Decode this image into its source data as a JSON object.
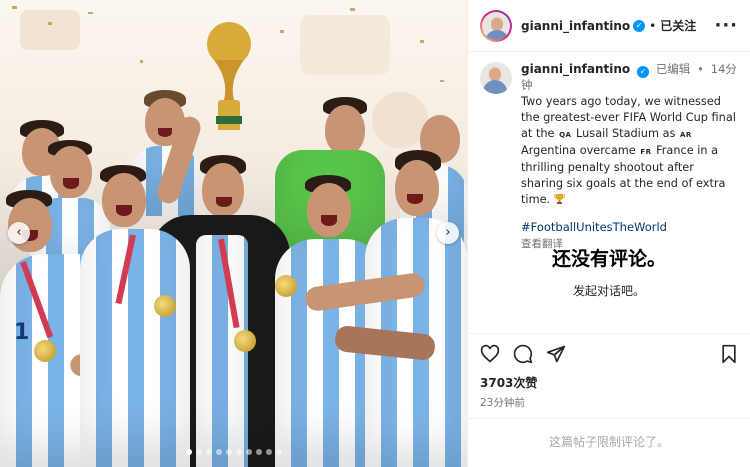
{
  "post": {
    "media": {
      "alt_description_hidden": "",
      "carousel_dots": 10,
      "active_dot": 0
    },
    "header": {
      "username": "gianni_infantino",
      "separator": "•",
      "follow_status": "已关注",
      "more_icon": "more-horizontal-icon"
    },
    "caption": {
      "username": "gianni_infantino",
      "edited": "已编辑",
      "separator": "•",
      "age": "14分钟",
      "text_1": "Two years ago today, we witnessed the greatest-ever FIFA World Cup final at the",
      "flag_qa": "QA",
      "text_2": "Lusail Stadium as",
      "flag_ar": "AR",
      "text_3": "Argentina overcame",
      "flag_fr": "FR",
      "text_4": "France in a thrilling penalty shootout after sharing six goals at the end of extra time.",
      "hashtag": "#FootballUnitesTheWorld",
      "translate": "查看翻译"
    },
    "comments": {
      "empty_title": "还没有评论。",
      "empty_subtitle": "发起对话吧。"
    },
    "actions": {
      "icons": [
        "heart-icon",
        "comment-icon",
        "share-icon",
        "bookmark-icon"
      ],
      "likes": "3703次赞",
      "time": "23分钟前",
      "limited_comments": "这篇帖子限制评论了。"
    }
  },
  "colors": {
    "verified": "#0095f6",
    "hashtag": "#00376b",
    "secondary_text": "#737373",
    "argentina_sky_blue": "#7ab3e6",
    "medal_gold": "#d4af37"
  }
}
